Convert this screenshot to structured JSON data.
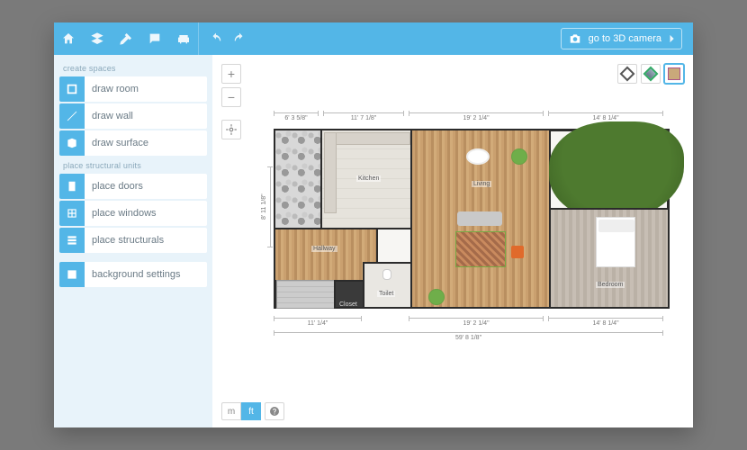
{
  "topbar": {
    "camera_label": "go to 3D camera"
  },
  "sidebar": {
    "group1_label": "create spaces",
    "group2_label": "place structural units",
    "draw_room": "draw room",
    "draw_wall": "draw wall",
    "draw_surface": "draw surface",
    "place_doors": "place doors",
    "place_windows": "place windows",
    "place_structurals": "place structurals",
    "background_settings": "background settings"
  },
  "units": {
    "m": "m",
    "ft": "ft"
  },
  "rooms": {
    "kitchen": "Kitchen",
    "living": "Living",
    "hallway": "Hallway",
    "toilet": "Toilet",
    "closet": "Closet",
    "bedroom": "Bedroom"
  },
  "dims": {
    "top_a": "6' 3 5/8\"",
    "top_b": "11' 7 1/8\"",
    "top_c": "19' 2 1/4\"",
    "top_d": "14' 8 1/4\"",
    "bot_a": "11' 1/4\"",
    "bot_b": "19' 2 1/4\"",
    "bot_c": "14' 8 1/4\"",
    "bot_total": "59' 8 1/8\"",
    "left_h": "8' 11 1/8\""
  }
}
